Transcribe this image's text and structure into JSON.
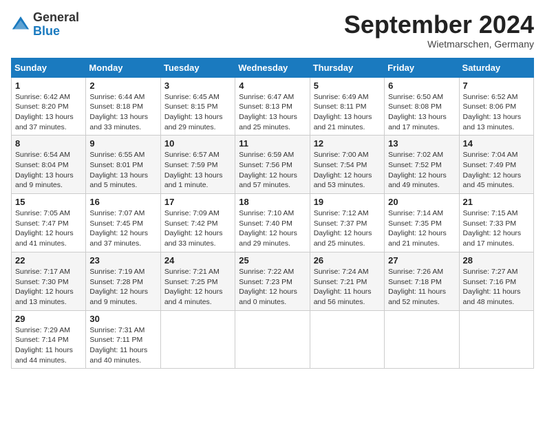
{
  "header": {
    "logo_line1": "General",
    "logo_line2": "Blue",
    "month_title": "September 2024",
    "subtitle": "Wietmarschen, Germany"
  },
  "days_of_week": [
    "Sunday",
    "Monday",
    "Tuesday",
    "Wednesday",
    "Thursday",
    "Friday",
    "Saturday"
  ],
  "weeks": [
    [
      {
        "day": "1",
        "detail": "Sunrise: 6:42 AM\nSunset: 8:20 PM\nDaylight: 13 hours\nand 37 minutes."
      },
      {
        "day": "2",
        "detail": "Sunrise: 6:44 AM\nSunset: 8:18 PM\nDaylight: 13 hours\nand 33 minutes."
      },
      {
        "day": "3",
        "detail": "Sunrise: 6:45 AM\nSunset: 8:15 PM\nDaylight: 13 hours\nand 29 minutes."
      },
      {
        "day": "4",
        "detail": "Sunrise: 6:47 AM\nSunset: 8:13 PM\nDaylight: 13 hours\nand 25 minutes."
      },
      {
        "day": "5",
        "detail": "Sunrise: 6:49 AM\nSunset: 8:11 PM\nDaylight: 13 hours\nand 21 minutes."
      },
      {
        "day": "6",
        "detail": "Sunrise: 6:50 AM\nSunset: 8:08 PM\nDaylight: 13 hours\nand 17 minutes."
      },
      {
        "day": "7",
        "detail": "Sunrise: 6:52 AM\nSunset: 8:06 PM\nDaylight: 13 hours\nand 13 minutes."
      }
    ],
    [
      {
        "day": "8",
        "detail": "Sunrise: 6:54 AM\nSunset: 8:04 PM\nDaylight: 13 hours\nand 9 minutes."
      },
      {
        "day": "9",
        "detail": "Sunrise: 6:55 AM\nSunset: 8:01 PM\nDaylight: 13 hours\nand 5 minutes."
      },
      {
        "day": "10",
        "detail": "Sunrise: 6:57 AM\nSunset: 7:59 PM\nDaylight: 13 hours\nand 1 minute."
      },
      {
        "day": "11",
        "detail": "Sunrise: 6:59 AM\nSunset: 7:56 PM\nDaylight: 12 hours\nand 57 minutes."
      },
      {
        "day": "12",
        "detail": "Sunrise: 7:00 AM\nSunset: 7:54 PM\nDaylight: 12 hours\nand 53 minutes."
      },
      {
        "day": "13",
        "detail": "Sunrise: 7:02 AM\nSunset: 7:52 PM\nDaylight: 12 hours\nand 49 minutes."
      },
      {
        "day": "14",
        "detail": "Sunrise: 7:04 AM\nSunset: 7:49 PM\nDaylight: 12 hours\nand 45 minutes."
      }
    ],
    [
      {
        "day": "15",
        "detail": "Sunrise: 7:05 AM\nSunset: 7:47 PM\nDaylight: 12 hours\nand 41 minutes."
      },
      {
        "day": "16",
        "detail": "Sunrise: 7:07 AM\nSunset: 7:45 PM\nDaylight: 12 hours\nand 37 minutes."
      },
      {
        "day": "17",
        "detail": "Sunrise: 7:09 AM\nSunset: 7:42 PM\nDaylight: 12 hours\nand 33 minutes."
      },
      {
        "day": "18",
        "detail": "Sunrise: 7:10 AM\nSunset: 7:40 PM\nDaylight: 12 hours\nand 29 minutes."
      },
      {
        "day": "19",
        "detail": "Sunrise: 7:12 AM\nSunset: 7:37 PM\nDaylight: 12 hours\nand 25 minutes."
      },
      {
        "day": "20",
        "detail": "Sunrise: 7:14 AM\nSunset: 7:35 PM\nDaylight: 12 hours\nand 21 minutes."
      },
      {
        "day": "21",
        "detail": "Sunrise: 7:15 AM\nSunset: 7:33 PM\nDaylight: 12 hours\nand 17 minutes."
      }
    ],
    [
      {
        "day": "22",
        "detail": "Sunrise: 7:17 AM\nSunset: 7:30 PM\nDaylight: 12 hours\nand 13 minutes."
      },
      {
        "day": "23",
        "detail": "Sunrise: 7:19 AM\nSunset: 7:28 PM\nDaylight: 12 hours\nand 9 minutes."
      },
      {
        "day": "24",
        "detail": "Sunrise: 7:21 AM\nSunset: 7:25 PM\nDaylight: 12 hours\nand 4 minutes."
      },
      {
        "day": "25",
        "detail": "Sunrise: 7:22 AM\nSunset: 7:23 PM\nDaylight: 12 hours\nand 0 minutes."
      },
      {
        "day": "26",
        "detail": "Sunrise: 7:24 AM\nSunset: 7:21 PM\nDaylight: 11 hours\nand 56 minutes."
      },
      {
        "day": "27",
        "detail": "Sunrise: 7:26 AM\nSunset: 7:18 PM\nDaylight: 11 hours\nand 52 minutes."
      },
      {
        "day": "28",
        "detail": "Sunrise: 7:27 AM\nSunset: 7:16 PM\nDaylight: 11 hours\nand 48 minutes."
      }
    ],
    [
      {
        "day": "29",
        "detail": "Sunrise: 7:29 AM\nSunset: 7:14 PM\nDaylight: 11 hours\nand 44 minutes."
      },
      {
        "day": "30",
        "detail": "Sunrise: 7:31 AM\nSunset: 7:11 PM\nDaylight: 11 hours\nand 40 minutes."
      },
      {
        "day": "",
        "detail": ""
      },
      {
        "day": "",
        "detail": ""
      },
      {
        "day": "",
        "detail": ""
      },
      {
        "day": "",
        "detail": ""
      },
      {
        "day": "",
        "detail": ""
      }
    ]
  ]
}
